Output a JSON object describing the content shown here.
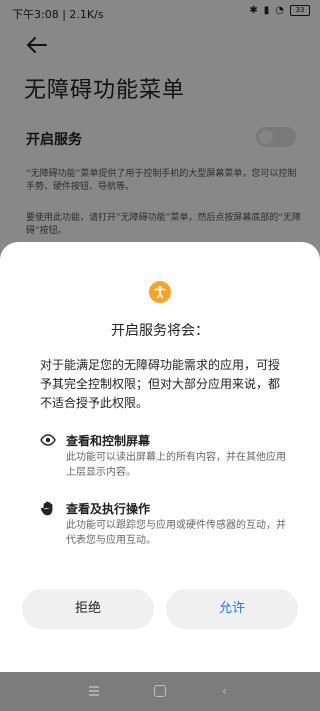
{
  "status_bar": {
    "time_speed": "下午3:08 | 2.1K/s",
    "battery": "33"
  },
  "page": {
    "title": "无障碍功能菜单",
    "service_label": "开启服务",
    "description1": "“无障碍功能”菜单提供了用于控制手机的大型屏幕菜单，您可以控制手势、硬件按钮、导航等。",
    "description2": "要使用此功能，请打开“无障碍功能”菜单，然后点按屏幕底部的“无障碍”按钮。"
  },
  "dialog": {
    "title": "开启服务将会：",
    "message": "对于能满足您的无障碍功能需求的应用，可授予其完全控制权限；但对大部分应用来说，都不适合授予此权限。",
    "permissions": [
      {
        "icon": "eye-icon",
        "title": "查看和控制屏幕",
        "desc": "此功能可以读出屏幕上的所有内容，并在其他应用上层显示内容。"
      },
      {
        "icon": "hand-icon",
        "title": "查看及执行操作",
        "desc": "此功能可以跟踪您与应用或硬件传感器的互动，并代表您与应用互动。"
      }
    ],
    "deny_label": "拒绝",
    "allow_label": "允许"
  },
  "colors": {
    "accent": "#1b7cf0",
    "badge": "#f3a523"
  }
}
